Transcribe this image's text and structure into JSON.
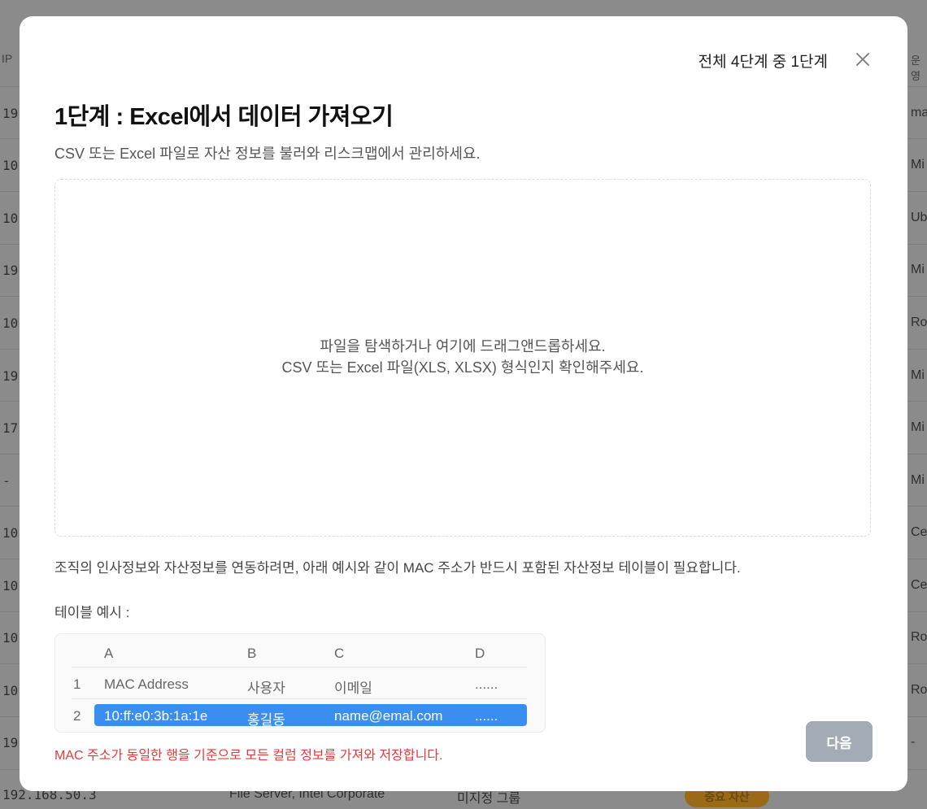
{
  "background": {
    "header_ip": "IP",
    "header_right": "운영",
    "left_cells": [
      "19",
      "10",
      "10",
      "19",
      "10",
      "19",
      "17",
      "-",
      "10",
      "10",
      "10",
      "10",
      "19"
    ],
    "right_cells": [
      "ma",
      "Mi",
      "Ub",
      "Mi",
      "Ro",
      "Mi",
      "Mi",
      "Mi",
      "Ce",
      "Ce",
      "Ro",
      "Ro",
      "-"
    ],
    "bottom_row": {
      "ip": "192.168.50.3",
      "name": "File Server, Intel Corporate",
      "group": "미지정 그룹",
      "badge": "중요 자산"
    }
  },
  "modal": {
    "step_indicator": "전체 4단계 중 1단계",
    "title": "1단계 : Excel에서 데이터 가져오기",
    "subtitle": "CSV 또는 Excel 파일로 자산 정보를 불러와 리스크맵에서 관리하세요.",
    "dropzone": {
      "line1": "파일을 탐색하거나 여기에 드래그앤드롭하세요.",
      "line2": "CSV 또는 Excel 파일(XLS, XLSX) 형식인지 확인해주세요."
    },
    "info_text": "조직의 인사정보와 자산정보를 연동하려면, 아래 예시와 같이 MAC 주소가 반드시 포함된 자산정보 테이블이 필요합니다.",
    "example_label": "테이블 예시 :",
    "example_table": {
      "columns": [
        "A",
        "B",
        "C",
        "D"
      ],
      "rows": [
        {
          "num": "1",
          "cells": [
            "MAC Address",
            "사용자",
            "이메일",
            "......"
          ]
        },
        {
          "num": "2",
          "cells": [
            "10:ff:e0:3b:1a:1e",
            "홍길동",
            "name@emal.com",
            "......"
          ]
        }
      ]
    },
    "warning_text": "MAC 주소가 동일한 행을 기준으로 모든 컬럼 정보를 가져와 저장합니다.",
    "next_button": "다음",
    "colors": {
      "highlight": "#3a8ef0",
      "warning": "#e03b3b",
      "button_disabled": "#a3abb7"
    }
  }
}
